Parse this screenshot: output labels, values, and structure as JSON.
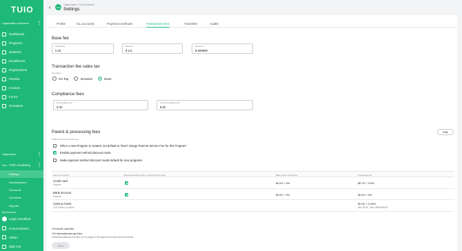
{
  "app": {
    "logo": "TUIO"
  },
  "sidebar": {
    "org_experience_label": "Organization experience",
    "nav": [
      {
        "label": "Dashboard",
        "icon": "dashboard-icon"
      },
      {
        "label": "Programs",
        "icon": "programs-icon"
      },
      {
        "label": "Students",
        "icon": "students-icon"
      },
      {
        "label": "Enrollments",
        "icon": "enrollments-icon"
      },
      {
        "label": "Registrations",
        "icon": "registrations-icon"
      },
      {
        "label": "Parents",
        "icon": "parents-icon"
      },
      {
        "label": "Invoices",
        "icon": "invoices-icon"
      },
      {
        "label": "Forms",
        "icon": "forms-icon"
      },
      {
        "label": "Donations",
        "icon": "donations-icon"
      }
    ],
    "organization_label": "Organization",
    "org_tag": "Tuio",
    "org_name": "TUIO Academy",
    "sub_nav": [
      "Settings",
      "Administrators",
      "Discounts",
      "Donations",
      "Reports"
    ],
    "my_account_label": "My Account",
    "bottom_nav": [
      {
        "label": "Leigh Sandiford",
        "icon": "avatar"
      },
      {
        "label": "Conversations",
        "icon": "chat-icon"
      },
      {
        "label": "Admin",
        "icon": "gear-icon"
      },
      {
        "label": "Sign Out",
        "icon": "logout-icon"
      }
    ]
  },
  "header": {
    "breadcrumb": "Organization / TUIO Academy",
    "title": "Settings",
    "avatar_initials": "TUIO"
  },
  "tabs": [
    "Profile",
    "GL accounts",
    "Payment methods",
    "Transaction fees",
    "Transfers",
    "Audits"
  ],
  "active_tab": "Transaction fees",
  "base_fee": {
    "title": "Base fee",
    "fields": [
      {
        "label": "Variable (%)",
        "value": "0.25"
      },
      {
        "label": "Minimum*",
        "value": "$ 2.5"
      },
      {
        "label": "Maximum*",
        "value": "$ 999999"
      }
    ]
  },
  "sales_tax": {
    "title": "Transaction fee sales tax",
    "mode_label": "Tax Mode*",
    "options": [
      "On Top",
      "Inclusive",
      "None"
    ],
    "selected": "None"
  },
  "compliance": {
    "title": "Compliance fees",
    "fields": [
      {
        "label": "PCI compliance fee*",
        "value": "$ 30"
      },
      {
        "label": "PCI non-compliance fee*",
        "value": "$ 60"
      }
    ]
  },
  "parent_fees": {
    "title": "Parent & processing fees",
    "edit_label": "Edit",
    "default_label": "Default for parent service fee",
    "checkboxes": [
      {
        "label": "When a new Program is created, set default to \"Don't charge Parents Service Fee for this Program\"",
        "checked": false
      },
      {
        "label": "Enable payment method discount mode",
        "checked": true
      },
      {
        "label": "Make payment method discount model default for new programs",
        "checked": false
      }
    ]
  },
  "table": {
    "headers": [
      "Payment method",
      "Include transaction fees in parent service fees",
      "Base parent service fee",
      "Processing fee"
    ],
    "rows": [
      {
        "name": "Credit card",
        "sub": "Paysafe",
        "include": true,
        "base": "$0.00 + 0%",
        "proc": "$0.75 + 3.5%",
        "proc_sub": ""
      },
      {
        "name": "Bank account",
        "sub": "Paysafe",
        "include": true,
        "base": "$0.00 + 0%",
        "proc": "$0.00 + 0%",
        "proc_sub": ""
      },
      {
        "name": "Cash & check",
        "sub": "TUIO Billing Contacts",
        "include": false,
        "base": "",
        "proc": "$0.00 + 0.25%",
        "proc_sub": "Min: $2.50 , Max: $999,999.00"
      }
    ]
  },
  "footer": {
    "notes": [
      "1% Amex card fee",
      "1% International card fee"
    ],
    "muted_note": "Amex/International card fees do not apply in the payment method discount model",
    "save_label": "Save"
  },
  "colors": {
    "brand": "#1eb978",
    "panel": "#ffffff",
    "background": "#f3f4f6"
  }
}
